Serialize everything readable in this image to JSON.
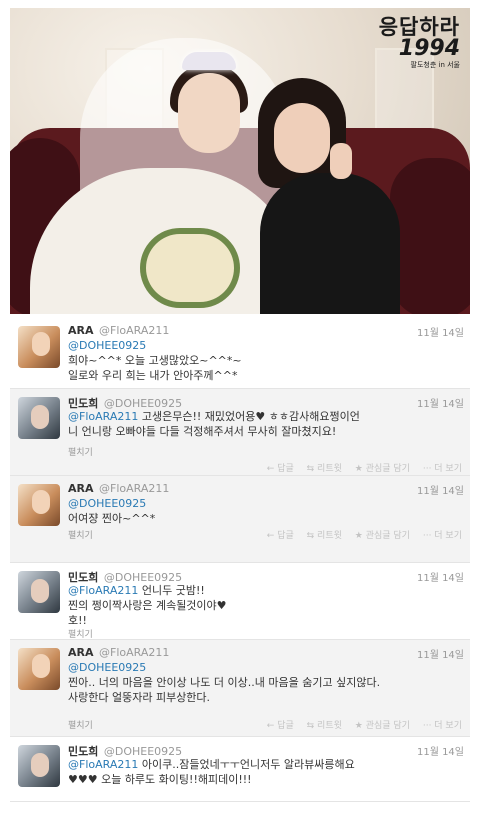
{
  "photo": {
    "logo_line1": "응답하라",
    "logo_line2": "1994",
    "logo_line3": "팔도청춘 in 서울"
  },
  "tweets": [
    {
      "name": "ARA",
      "handle": "@FloARA211",
      "date": "11월 14일",
      "mention": "@DOHEE0925",
      "text_lines": [
        "희야~^^* 오늘 고생많았오~^^*~",
        "일로와 우리 희는 내가 안아주께^^*"
      ],
      "expand": "",
      "actions": []
    },
    {
      "name": "민도희",
      "handle": "@DOHEE0925",
      "date": "11월 14일",
      "mention": "@FloARA211",
      "first_text": "고생은무슨!! 재밌었어용♥ ㅎㅎ감사해요쩡이언",
      "text_lines": [
        "니 언니랑 오빠야들 다들 걱정해주셔서 무사히 잘마쳤지요!"
      ],
      "expand": "펼치기",
      "actions": [
        "← 답글",
        "⇆ 리트윗",
        "★ 관심글 담기",
        "··· 더 보기"
      ]
    },
    {
      "name": "ARA",
      "handle": "@FloARA211",
      "date": "11월 14일",
      "mention": "@DOHEE0925",
      "text_lines": [
        "어여쟝 찐아~^^*"
      ],
      "expand": "펼치기",
      "actions": [
        "← 답글",
        "⇆ 리트윗",
        "★ 관심글 담기",
        "··· 더 보기"
      ]
    },
    {
      "name": "민도희",
      "handle": "@DOHEE0925",
      "date": "11월 14일",
      "mention": "@FloARA211",
      "first_text": "언니두 굿밤!!",
      "text_lines": [
        "찐의 쩡이짝사랑은 계속될것이야♥",
        "호!!"
      ],
      "expand": "펼치기",
      "actions": []
    },
    {
      "name": "ARA",
      "handle": "@FloARA211",
      "date": "11월 14일",
      "mention": "@DOHEE0925",
      "text_lines": [
        "찐아.. 너의 마음을 안이상 나도 더 이상..내 마음을 숨기고 싶지않다.",
        "사랑한다 얼뚱자라 피부상한다."
      ],
      "expand": "펼치기",
      "actions": [
        "← 답글",
        "⇆ 리트윗",
        "★ 관심글 담기",
        "··· 더 보기"
      ]
    },
    {
      "name": "민도희",
      "handle": "@DOHEE0925",
      "date": "11월 14일",
      "mention": "@FloARA211",
      "first_text": "아이쿠..잠들었네ㅜㅜ언니저두 알라뷰싸릉해요",
      "text_lines": [
        "♥♥♥ 오늘 하루도 화이팅!!해피데이!!!"
      ],
      "expand": "",
      "actions": []
    }
  ]
}
